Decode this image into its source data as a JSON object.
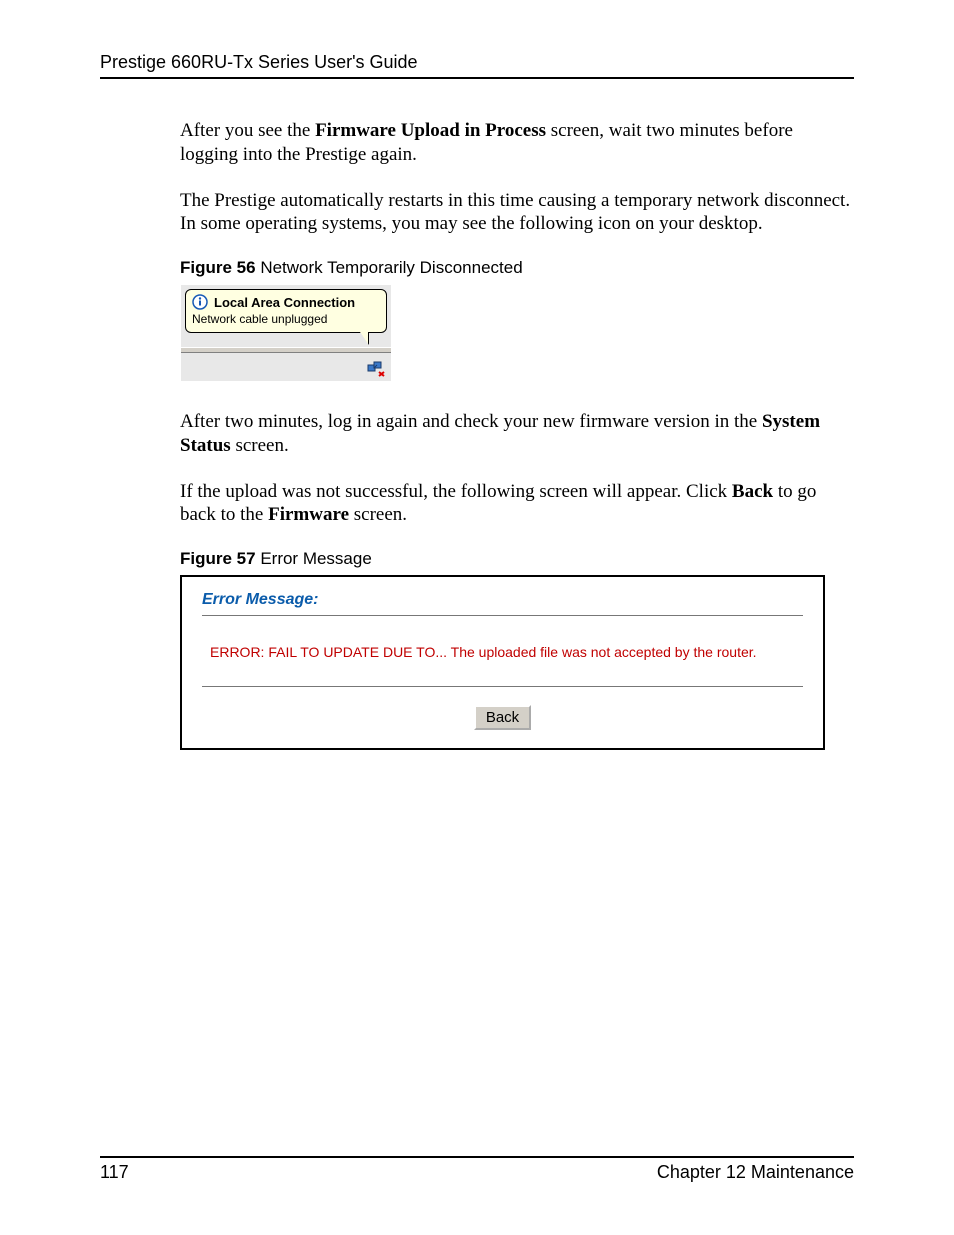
{
  "header": {
    "guide_title": "Prestige 660RU-Tx Series User's Guide"
  },
  "paragraphs": {
    "p1_pre": "After you see the ",
    "p1_bold": "Firmware Upload in Process",
    "p1_post": " screen, wait two minutes before logging into the Prestige again.",
    "p2": "The Prestige automatically restarts in this time causing a temporary network disconnect. In some operating systems, you may see the following icon on your desktop.",
    "p3_pre": "After two minutes, log in again and check your new firmware version in the ",
    "p3_bold": "System Status",
    "p3_post": " screen.",
    "p4_pre": "If the upload was not successful, the following screen will appear.  Click ",
    "p4_bold1": "Back",
    "p4_mid": " to go back to the ",
    "p4_bold2": "Firmware",
    "p4_post": " screen."
  },
  "figures": {
    "f56_num": "Figure 56",
    "f56_title": "   Network Temporarily Disconnected",
    "f57_num": "Figure 57",
    "f57_title": "   Error Message"
  },
  "balloon": {
    "title": "Local Area Connection",
    "message": "Network cable unplugged"
  },
  "error_dialog": {
    "heading": "Error Message:",
    "body": "ERROR: FAIL TO UPDATE DUE TO... The uploaded file was not accepted by the router.",
    "back_label": "Back"
  },
  "footer": {
    "page_number": "117",
    "chapter": "Chapter 12 Maintenance"
  }
}
